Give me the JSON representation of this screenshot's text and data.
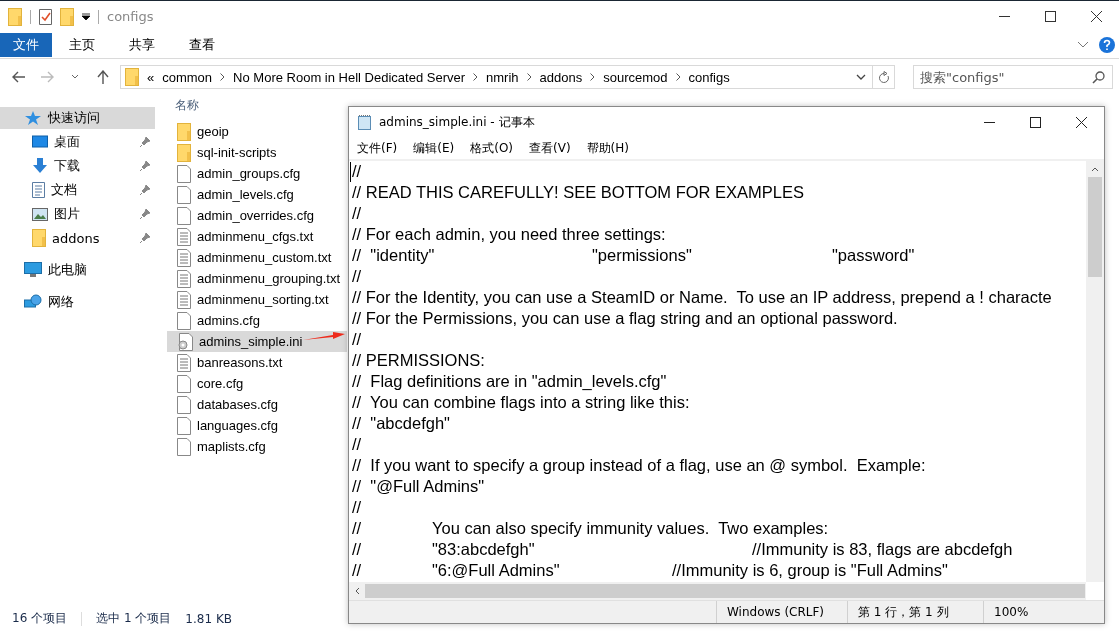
{
  "window": {
    "title": "configs"
  },
  "ribbon_tabs": [
    {
      "label": "文件",
      "kind": "file_menu"
    },
    {
      "label": "主页",
      "kind": "tab"
    },
    {
      "label": "共享",
      "kind": "tab"
    },
    {
      "label": "查看",
      "kind": "tab"
    }
  ],
  "address_bar": {
    "overflow": "«",
    "crumbs": [
      "common",
      "No More Room in Hell Dedicated Server",
      "nmrih",
      "addons",
      "sourcemod",
      "configs"
    ]
  },
  "search": {
    "placeholder": "搜索\"configs\""
  },
  "sidebar": {
    "items": [
      {
        "label": "快速访问",
        "kind": "star",
        "selected": true,
        "children": [
          {
            "label": "桌面",
            "kind": "desktop",
            "selected": false
          },
          {
            "label": "下载",
            "kind": "download",
            "selected": false
          },
          {
            "label": "文档",
            "kind": "document",
            "selected": false
          },
          {
            "label": "图片",
            "kind": "picture",
            "selected": false
          },
          {
            "label": "addons",
            "kind": "folder",
            "selected": false
          }
        ]
      },
      {
        "label": "此电脑",
        "kind": "computer",
        "selected": false
      },
      {
        "label": "网络",
        "kind": "network",
        "selected": false
      }
    ]
  },
  "file_list": {
    "columns": [
      "名称"
    ],
    "rows": [
      {
        "name": "geoip",
        "kind": "folder",
        "selected": false
      },
      {
        "name": "sql-init-scripts",
        "kind": "folder",
        "selected": false
      },
      {
        "name": "admin_groups.cfg",
        "kind": "file",
        "selected": false
      },
      {
        "name": "admin_levels.cfg",
        "kind": "file",
        "selected": false
      },
      {
        "name": "admin_overrides.cfg",
        "kind": "file",
        "selected": false
      },
      {
        "name": "adminmenu_cfgs.txt",
        "kind": "text",
        "selected": false
      },
      {
        "name": "adminmenu_custom.txt",
        "kind": "text",
        "selected": false
      },
      {
        "name": "adminmenu_grouping.txt",
        "kind": "text",
        "selected": false
      },
      {
        "name": "adminmenu_sorting.txt",
        "kind": "text",
        "selected": false
      },
      {
        "name": "admins.cfg",
        "kind": "file",
        "selected": false
      },
      {
        "name": "admins_simple.ini",
        "kind": "settings",
        "selected": true
      },
      {
        "name": "banreasons.txt",
        "kind": "text",
        "selected": false
      },
      {
        "name": "core.cfg",
        "kind": "file",
        "selected": false
      },
      {
        "name": "databases.cfg",
        "kind": "file",
        "selected": false
      },
      {
        "name": "languages.cfg",
        "kind": "file",
        "selected": false
      },
      {
        "name": "maplists.cfg",
        "kind": "file",
        "selected": false
      }
    ]
  },
  "status_bar": {
    "count": "16 个项目",
    "selection": "选中 1 个项目",
    "size": "1.81 KB"
  },
  "notepad": {
    "title": "admins_simple.ini - 记事本",
    "menu": [
      "文件(F)",
      "编辑(E)",
      "格式(O)",
      "查看(V)",
      "帮助(H)"
    ],
    "lines": [
      "//",
      "// READ THIS CAREFULLY! SEE BOTTOM FOR EXAMPLES",
      "//",
      "// For each admin, you need three settings:",
      "//  \"identity\"\t\t\t\t\"permissions\"\t\t\t\t\"password\"",
      "//",
      "// For the Identity, you can use a SteamID or Name.  To use an IP address, prepend a ! characte",
      "// For the Permissions, you can use a flag string and an optional password.",
      "//",
      "// PERMISSIONS:",
      "//  Flag definitions are in \"admin_levels.cfg\"",
      "//  You can combine flags into a string like this:",
      "//  \"abcdefgh\"",
      "//",
      "//  If you want to specify a group instead of a flag, use an @ symbol.  Example:",
      "//  \"@Full Admins\"",
      "//",
      "//\t\tYou can also specify immunity values.  Two examples:",
      "//\t\t\"83:abcdefgh\"\t\t\t\t\t\t//Immunity is 83, flags are abcdefgh",
      "//\t\t\"6:@Full Admins\"\t\t\t//Immunity is 6, group is \"Full Admins\""
    ],
    "status": [
      "Windows (CRLF)",
      "第 1 行，第 1 列",
      "100%"
    ]
  }
}
